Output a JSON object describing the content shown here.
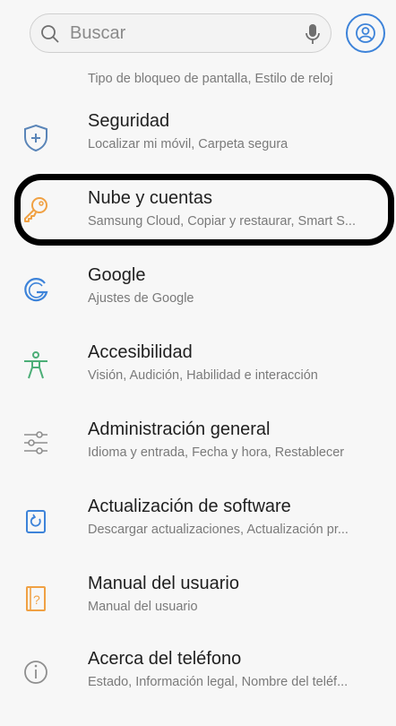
{
  "search": {
    "placeholder": "Buscar"
  },
  "items": [
    {
      "title": "",
      "subtitle": "Tipo de bloqueo de pantalla, Estilo de reloj",
      "icon": "lockscreen-icon"
    },
    {
      "title": "Seguridad",
      "subtitle": "Localizar mi móvil, Carpeta segura",
      "icon": "shield-icon"
    },
    {
      "title": "Nube y cuentas",
      "subtitle": "Samsung Cloud, Copiar y restaurar, Smart S...",
      "icon": "key-icon"
    },
    {
      "title": "Google",
      "subtitle": "Ajustes de Google",
      "icon": "google-icon"
    },
    {
      "title": "Accesibilidad",
      "subtitle": "Visión, Audición, Habilidad e interacción",
      "icon": "accessibility-icon"
    },
    {
      "title": "Administración general",
      "subtitle": "Idioma y entrada, Fecha y hora, Restablecer",
      "icon": "sliders-icon"
    },
    {
      "title": "Actualización de software",
      "subtitle": "Descargar actualizaciones, Actualización pr...",
      "icon": "update-icon"
    },
    {
      "title": "Manual del usuario",
      "subtitle": "Manual del usuario",
      "icon": "manual-icon"
    },
    {
      "title": "Acerca del teléfono",
      "subtitle": "Estado, Información legal, Nombre del teléf...",
      "icon": "info-icon"
    }
  ],
  "colors": {
    "accent_blue": "#3d83d9",
    "security_blue": "#5a85b8",
    "orange": "#f0a144",
    "green": "#4cae77",
    "grey": "#8e8e8e"
  }
}
